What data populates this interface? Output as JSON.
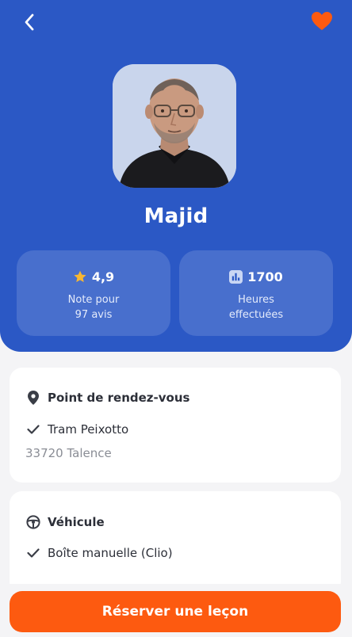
{
  "profile": {
    "name": "Majid"
  },
  "stats": {
    "rating": {
      "value": "4,9",
      "label_line1": "Note pour",
      "label_line2": "97 avis",
      "icon": "star-icon"
    },
    "hours": {
      "value": "1700",
      "label_line1": "Heures",
      "label_line2": "effectuées",
      "icon": "bar-chart-icon"
    }
  },
  "meeting_point": {
    "title": "Point de rendez-vous",
    "place": "Tram Peixotto",
    "address": "33720 Talence"
  },
  "vehicle": {
    "title": "Véhicule",
    "gearbox": "Boîte manuelle (Clio)"
  },
  "actions": {
    "book_label": "Réserver une leçon"
  },
  "colors": {
    "primary_blue": "#2b58c5",
    "accent_orange": "#fd5a10",
    "star_yellow": "#f7b733"
  }
}
